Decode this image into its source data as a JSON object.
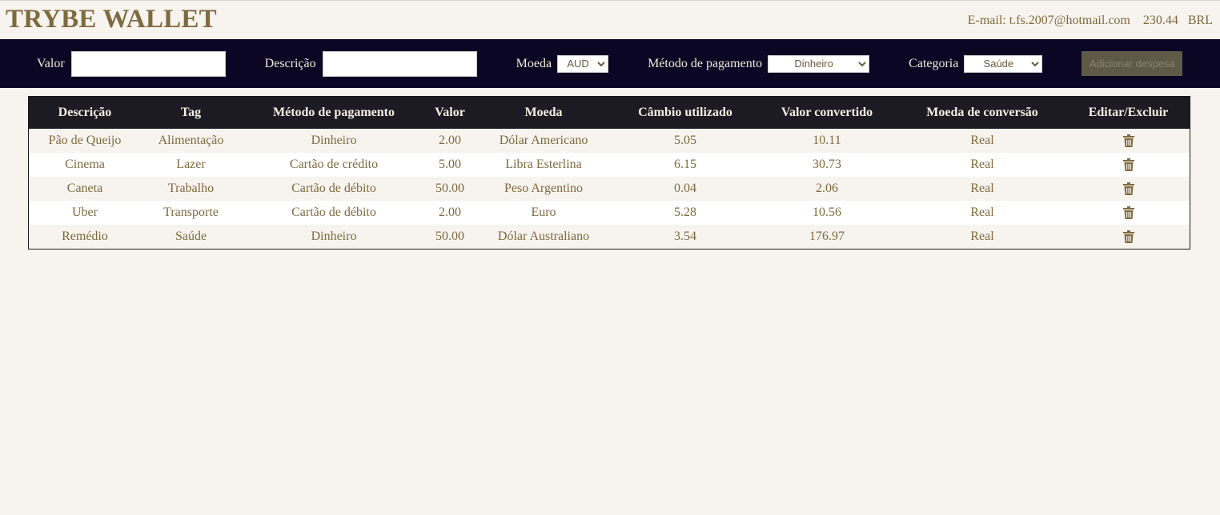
{
  "header": {
    "brand": "TRYBE WALLET",
    "email_label": "E-mail: t.fs.2007@hotmail.com",
    "total": "230.44",
    "currency": "BRL"
  },
  "form": {
    "valor_label": "Valor",
    "descricao_label": "Descrição",
    "moeda_label": "Moeda",
    "moeda_value": "AUD",
    "metodo_label": "Método de pagamento",
    "metodo_value": "Dinheiro",
    "categoria_label": "Categoria",
    "categoria_value": "Saúde",
    "add_button": "Adicionar despesa"
  },
  "table": {
    "headers": [
      "Descrição",
      "Tag",
      "Método de pagamento",
      "Valor",
      "Moeda",
      "Câmbio utilizado",
      "Valor convertido",
      "Moeda de conversão",
      "Editar/Excluir"
    ],
    "rows": [
      [
        "Pão de Queijo",
        "Alimentação",
        "Dinheiro",
        "2.00",
        "Dólar Americano",
        "5.05",
        "10.11",
        "Real"
      ],
      [
        "Cinema",
        "Lazer",
        "Cartão de crédito",
        "5.00",
        "Libra Esterlina",
        "6.15",
        "30.73",
        "Real"
      ],
      [
        "Caneta",
        "Trabalho",
        "Cartão de débito",
        "50.00",
        "Peso Argentino",
        "0.04",
        "2.06",
        "Real"
      ],
      [
        "Uber",
        "Transporte",
        "Cartão de débito",
        "2.00",
        "Euro",
        "5.28",
        "10.56",
        "Real"
      ],
      [
        "Remédio",
        "Saúde",
        "Dinheiro",
        "50.00",
        "Dólar Australiano",
        "3.54",
        "176.97",
        "Real"
      ]
    ]
  },
  "icons": {
    "delete": "trash-icon"
  },
  "colors": {
    "accent": "#7d6a3e",
    "bar": "#0a0624",
    "table_header": "#1c1b24"
  }
}
